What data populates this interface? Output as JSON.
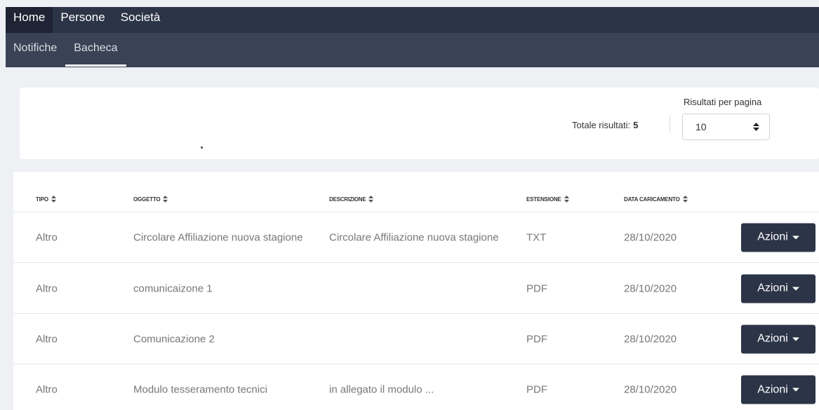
{
  "nav": {
    "items": [
      {
        "label": "Home",
        "active": true
      },
      {
        "label": "Persone",
        "active": false
      },
      {
        "label": "Società",
        "active": false
      }
    ]
  },
  "subnav": {
    "items": [
      {
        "label": "Notifiche",
        "active": false
      },
      {
        "label": "Bacheca",
        "active": true
      }
    ]
  },
  "filters": {
    "total_label": "Totale risultati:",
    "total_value": "5",
    "per_page_label": "Risultati per pagina",
    "per_page_value": "10"
  },
  "table": {
    "columns": [
      "TIPO",
      "OGGETTO",
      "DESCRIZIONE",
      "ESTENSIONE",
      "DATA CARICAMENTO"
    ],
    "rows": [
      {
        "tipo": "Altro",
        "oggetto": "Circolare Affiliazione nuova stagione",
        "descrizione": "Circolare Affiliazione nuova stagione",
        "estensione": "TXT",
        "data": "28/10/2020",
        "azioni": "Azioni"
      },
      {
        "tipo": "Altro",
        "oggetto": "comunicaizone 1",
        "descrizione": "",
        "estensione": "PDF",
        "data": "28/10/2020",
        "azioni": "Azioni"
      },
      {
        "tipo": "Altro",
        "oggetto": "Comunicazione 2",
        "descrizione": "",
        "estensione": "PDF",
        "data": "28/10/2020",
        "azioni": "Azioni"
      },
      {
        "tipo": "Altro",
        "oggetto": "Modulo tesseramento tecnici",
        "descrizione": "in allegato il modulo ...",
        "estensione": "PDF",
        "data": "28/10/2020",
        "azioni": "Azioni"
      }
    ]
  },
  "colors": {
    "navbar": "#2c3447",
    "subnav": "#3a4255",
    "button": "#2c3447",
    "background": "#eef0f4"
  }
}
